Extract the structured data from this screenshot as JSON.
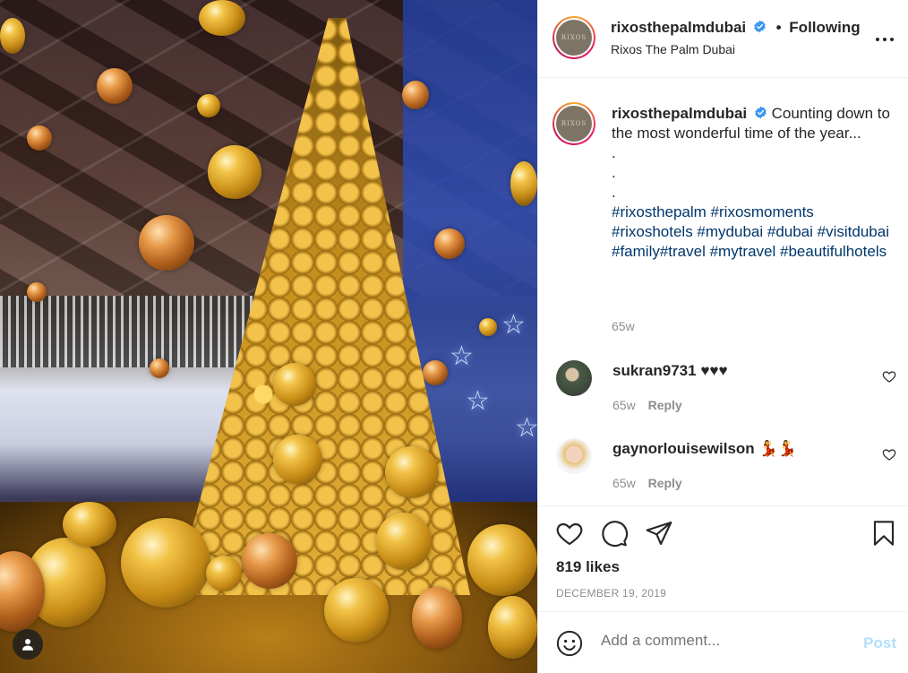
{
  "header": {
    "username": "rixosthepalmdubai",
    "separator": "•",
    "follow_state": "Following",
    "location": "Rixos The Palm Dubai",
    "avatar_text": "RIXOS"
  },
  "caption": {
    "username": "rixosthepalmdubai",
    "text": "Counting down to the most wonderful time of the year...",
    "dots": [
      ".",
      ".",
      "."
    ],
    "hashtags": "#rixosthepalm #rixosmoments #rixoshotels #mydubai #dubai #visitdubai #family#travel #mytravel #beautifulhotels",
    "time": "65w"
  },
  "comments": [
    {
      "username": "sukran9731",
      "text": "♥♥♥",
      "time": "65w",
      "reply_label": "Reply"
    },
    {
      "username": "gaynorlouisewilson",
      "text": "💃💃",
      "time": "65w",
      "reply_label": "Reply"
    }
  ],
  "actions": {
    "likes": "819 likes",
    "date": "DECEMBER 19, 2019"
  },
  "add_comment": {
    "placeholder": "Add a comment...",
    "post_label": "Post"
  },
  "colors": {
    "text": "#262626",
    "muted": "#8e8e8e",
    "hashtag": "#00376b",
    "verified": "#3897f0",
    "post_disabled": "#b2dffc",
    "divider": "#efefef"
  },
  "icons": [
    "verified-badge-icon",
    "more-options-icon",
    "heart-icon",
    "comment-icon",
    "share-icon",
    "bookmark-icon",
    "emoji-icon",
    "user-tag-icon"
  ]
}
